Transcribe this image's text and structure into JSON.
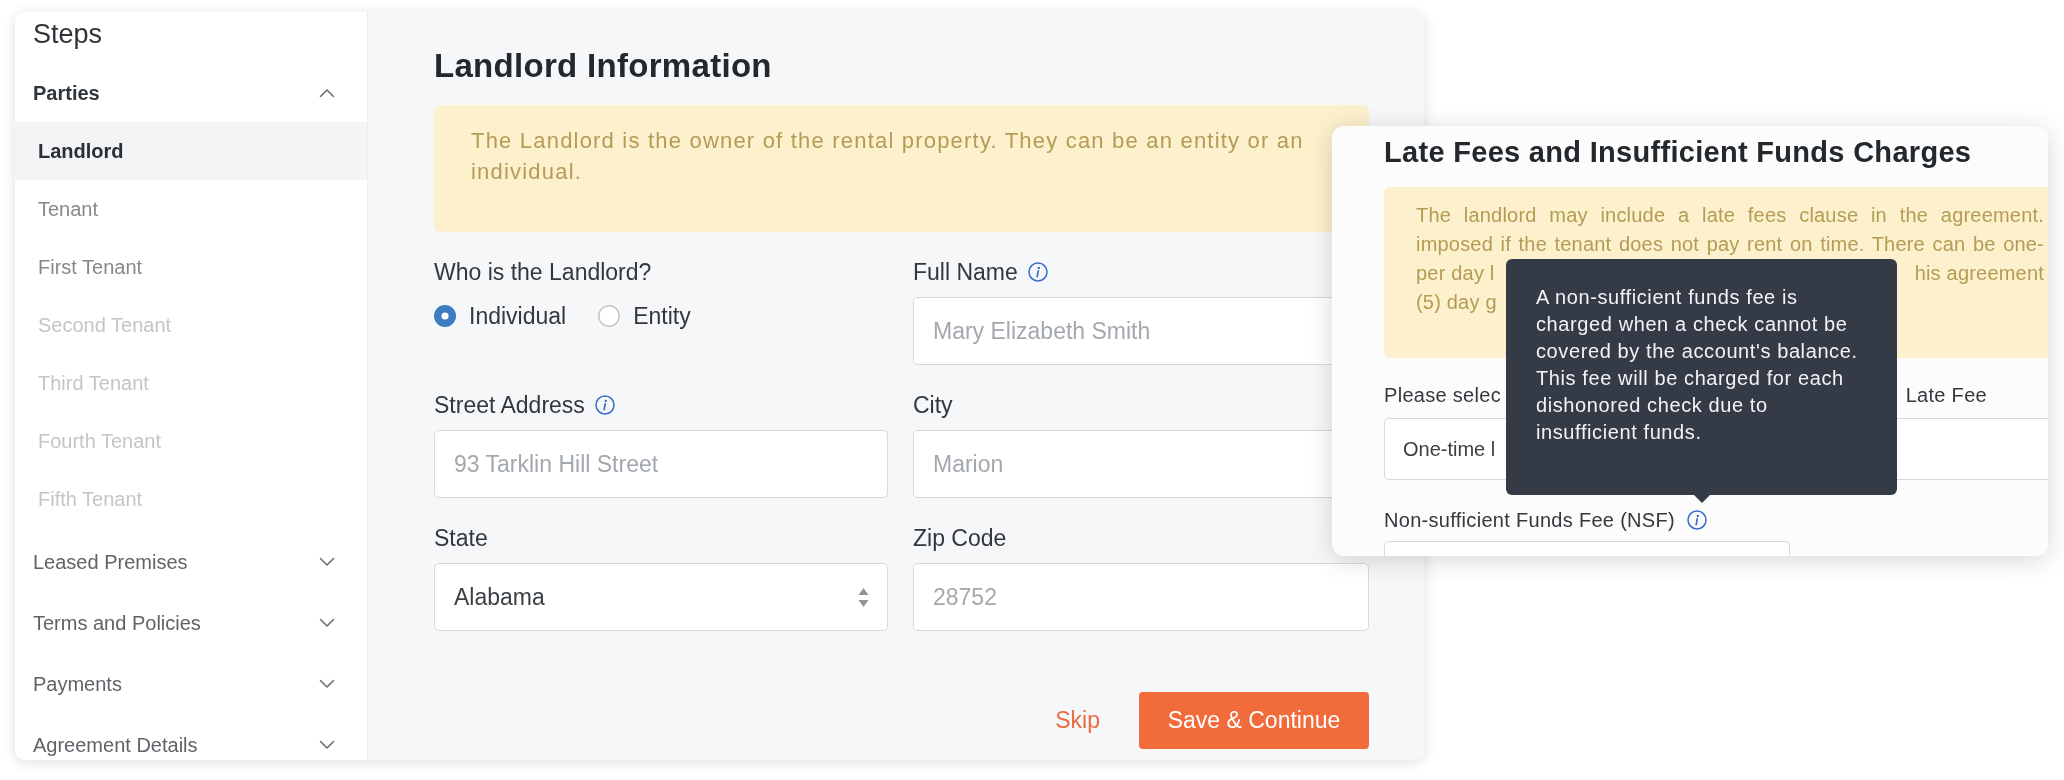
{
  "sidebar": {
    "title": "Steps",
    "sections": [
      {
        "label": "Parties",
        "expanded": true,
        "children": [
          {
            "label": "Landlord",
            "selected": true,
            "disabled": false
          },
          {
            "label": "Tenant",
            "selected": false,
            "disabled": false
          },
          {
            "label": "First Tenant",
            "selected": false,
            "disabled": false
          },
          {
            "label": "Second Tenant",
            "selected": false,
            "disabled": true
          },
          {
            "label": "Third Tenant",
            "selected": false,
            "disabled": true
          },
          {
            "label": "Fourth Tenant",
            "selected": false,
            "disabled": true
          },
          {
            "label": "Fifth Tenant",
            "selected": false,
            "disabled": true
          }
        ]
      },
      {
        "label": "Leased Premises",
        "expanded": false
      },
      {
        "label": "Terms and Policies",
        "expanded": false
      },
      {
        "label": "Payments",
        "expanded": false
      },
      {
        "label": "Agreement Details",
        "expanded": false
      }
    ]
  },
  "form": {
    "title": "Landlord Information",
    "notice": "The Landlord is the owner of the rental property. They can be an entity or an individual.",
    "fields": [
      {
        "kind": "radio",
        "label": "Who is the Landlord?",
        "info": false,
        "options": [
          {
            "label": "Individual",
            "selected": true
          },
          {
            "label": "Entity",
            "selected": false
          }
        ]
      },
      {
        "kind": "text",
        "label": "Full Name",
        "info": true,
        "placeholder": "Mary Elizabeth Smith"
      },
      {
        "kind": "text",
        "label": "Street Address",
        "info": true,
        "placeholder": "93 Tarklin Hill Street"
      },
      {
        "kind": "text",
        "label": "City",
        "info": false,
        "placeholder": "Marion"
      },
      {
        "kind": "select",
        "label": "State",
        "info": false,
        "value": "Alabama"
      },
      {
        "kind": "text",
        "label": "Zip Code",
        "info": false,
        "placeholder": "28752"
      }
    ],
    "skip": "Skip",
    "submit": "Save & Continue"
  },
  "late_fees_card": {
    "title": "Late Fees and Insufficient Funds Charges",
    "notice_lines": [
      {
        "kind": "full",
        "text": "The landlord may include a late fees clause in the agreement."
      },
      {
        "kind": "full",
        "text": "imposed if the tenant does not pay rent on time. There can be one-"
      },
      {
        "kind": "covered",
        "text": "per day l",
        "text_end": "his agreement"
      },
      {
        "kind": "covered",
        "text": "(5) day g"
      }
    ],
    "fields": [
      {
        "kind": "value",
        "label": "Please selec",
        "label_end": "Late Fee",
        "info": false,
        "value": "One-time l"
      },
      {
        "kind": "empty",
        "label": "Non-sufficient Funds Fee (NSF)",
        "info": true
      }
    ]
  },
  "tooltip": {
    "text": "A non-sufficient funds fee is charged when a check cannot be covered by the account's balance. This fee will be charged for each dishonored check due to insufficient funds."
  }
}
